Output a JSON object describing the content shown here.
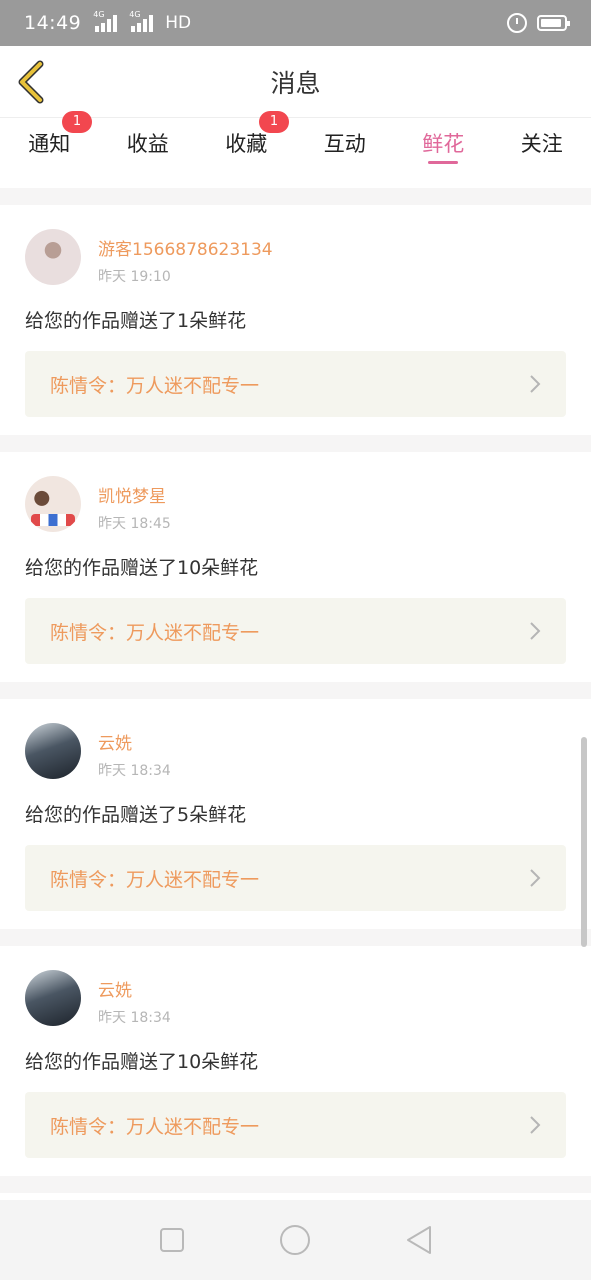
{
  "status_bar": {
    "time": "14:49",
    "network1": "4G",
    "network2": "4G",
    "hd": "HD"
  },
  "header": {
    "title": "消息"
  },
  "tabs": [
    {
      "label": "通知",
      "badge": "1"
    },
    {
      "label": "收益",
      "badge": ""
    },
    {
      "label": "收藏",
      "badge": "1"
    },
    {
      "label": "互动",
      "badge": ""
    },
    {
      "label": "鲜花",
      "badge": "",
      "active": true
    },
    {
      "label": "关注",
      "badge": ""
    }
  ],
  "messages": [
    {
      "username": "游客1566878623134",
      "time": "昨天 19:10",
      "message": "给您的作品赠送了1朵鲜花",
      "work": "陈情令：万人迷不配专一"
    },
    {
      "username": "凯悦梦星",
      "time": "昨天 18:45",
      "message": "给您的作品赠送了10朵鲜花",
      "work": "陈情令：万人迷不配专一"
    },
    {
      "username": "云姺",
      "time": "昨天 18:34",
      "message": "给您的作品赠送了5朵鲜花",
      "work": "陈情令：万人迷不配专一"
    },
    {
      "username": "云姺",
      "time": "昨天 18:34",
      "message": "给您的作品赠送了10朵鲜花",
      "work": "陈情令：万人迷不配专一"
    }
  ],
  "colors": {
    "accent_pink": "#e0689a",
    "username_orange": "#ee9a5d",
    "badge_red": "#f2474f",
    "back_arrow": "#e8c23a"
  }
}
